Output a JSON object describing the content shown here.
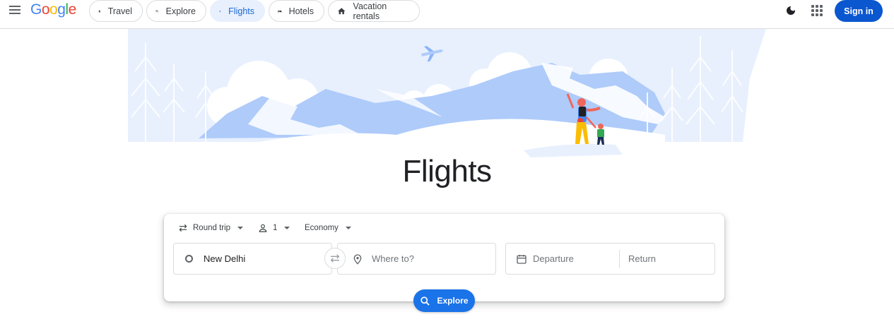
{
  "header": {
    "logo_text": "Google",
    "nav": {
      "travel": "Travel",
      "explore": "Explore",
      "flights": "Flights",
      "hotels": "Hotels",
      "vacation_rentals": "Vacation rentals"
    },
    "active_tab": "Flights",
    "sign_in": "Sign in"
  },
  "hero": {
    "title": "Flights"
  },
  "search": {
    "trip_type": "Round trip",
    "passengers": "1",
    "cabin_class": "Economy",
    "from": "New Delhi",
    "to_placeholder": "Where to?",
    "departure_placeholder": "Departure",
    "return_placeholder": "Return",
    "explore_button": "Explore"
  },
  "colors": {
    "primary": "#1a73e8",
    "sign_in_bg": "#0b57d0",
    "active_chip_bg": "#e8f0fe",
    "active_chip_text": "#1967d2",
    "illustration_blue": "#aecbfa",
    "illustration_light": "#e8f0fe"
  },
  "icons": {
    "menu": "hamburger-menu-icon",
    "travel": "suitcase-icon",
    "explore": "explore-search-icon",
    "flights": "airplane-icon",
    "hotels": "bed-icon",
    "vacation": "house-icon",
    "theme": "moon-icon",
    "apps": "apps-grid-icon",
    "trip": "swap-arrows-icon",
    "passenger": "person-icon",
    "origin": "origin-circle-icon",
    "destination": "location-pin-icon",
    "calendar": "calendar-icon",
    "search": "search-icon"
  }
}
